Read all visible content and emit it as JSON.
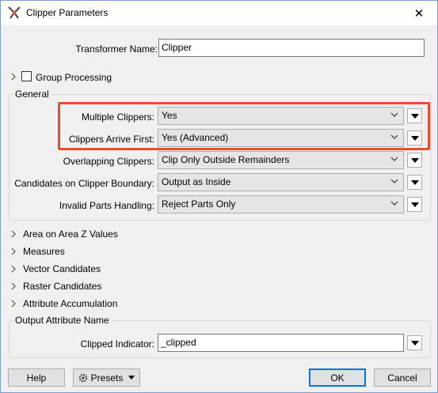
{
  "window": {
    "title": "Clipper Parameters",
    "close_glyph": "✕"
  },
  "transformer": {
    "name_label": "Transformer Name:",
    "name_value": "Clipper"
  },
  "group_processing": {
    "label": "Group Processing",
    "checked": false
  },
  "general": {
    "legend": "General",
    "rows": [
      {
        "label": "Multiple Clippers:",
        "value": "Yes"
      },
      {
        "label": "Clippers Arrive First:",
        "value": "Yes (Advanced)"
      },
      {
        "label": "Overlapping Clippers:",
        "value": "Clip Only Outside Remainders"
      },
      {
        "label": "Candidates on Clipper Boundary:",
        "value": "Output as Inside"
      },
      {
        "label": "Invalid Parts Handling:",
        "value": "Reject Parts Only"
      }
    ],
    "highlight_color": "#ee4b2b"
  },
  "sections": [
    {
      "label": "Area on Area Z Values"
    },
    {
      "label": "Measures"
    },
    {
      "label": "Vector Candidates"
    },
    {
      "label": "Raster Candidates"
    },
    {
      "label": "Attribute Accumulation"
    }
  ],
  "output": {
    "legend": "Output Attribute Name",
    "clipped_label": "Clipped Indicator:",
    "clipped_value": "_clipped"
  },
  "footer": {
    "help": "Help",
    "presets": "Presets",
    "ok": "OK",
    "cancel": "Cancel"
  },
  "icons": {
    "app": "fme-transformer-icon",
    "presets": "gear-icon",
    "expander": "chevron-right-icon",
    "combo": "chevron-down-icon",
    "menu": "triangle-down-icon"
  }
}
